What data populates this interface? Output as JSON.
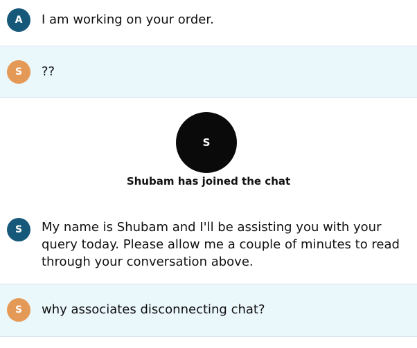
{
  "messages": [
    {
      "sender_initial": "A",
      "role": "agent",
      "text": "I am working on your order."
    },
    {
      "sender_initial": "S",
      "role": "customer",
      "text": "??"
    },
    {
      "sender_initial": "S",
      "role": "agent",
      "text": "My name is Shubam and I'll be assisting you with your query today. Please allow me a couple of minutes to read through your conversation above."
    },
    {
      "sender_initial": "S",
      "role": "customer",
      "text": "why associates disconnecting chat?"
    }
  ],
  "join_event": {
    "avatar_initial": "S",
    "text": "Shubam has joined the chat"
  },
  "colors": {
    "agent_avatar": "#16587a",
    "customer_avatar": "#e59956",
    "customer_bubble_bg": "#eaf7fb",
    "join_avatar": "#0a0a0a"
  }
}
